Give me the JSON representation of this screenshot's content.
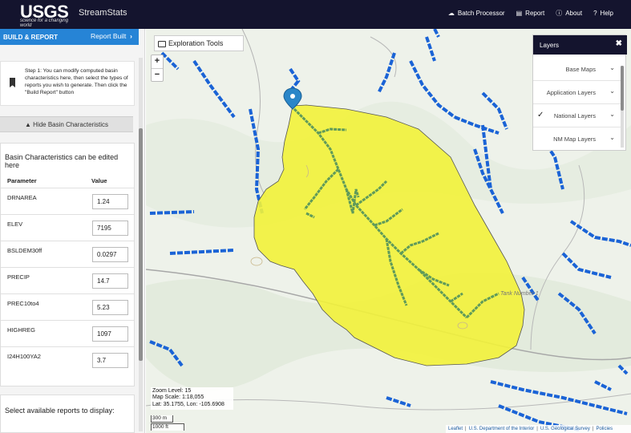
{
  "header": {
    "logo_text": "USGS",
    "logo_tagline": "science for a changing world",
    "app_title": "StreamStats",
    "nav": [
      {
        "label": "Batch Processor",
        "icon": "cloud-icon"
      },
      {
        "label": "Report",
        "icon": "document-icon"
      },
      {
        "label": "About",
        "icon": "info-icon"
      },
      {
        "label": "Help",
        "icon": "help-icon"
      }
    ],
    "background_color": "#14142e"
  },
  "sidebar": {
    "build_title": "BUILD & REPORT",
    "build_status": "Report Built",
    "build_chevron": "›",
    "step_text": "Step 1: You can modify computed basin characteristics here, then select the types of reports you wish to generate. Then click the \"Build Report\" button",
    "hide_button": "Hide Basin Characteristics",
    "basin_title": "Basin Characteristics can be edited here",
    "table_headers": {
      "parameter": "Parameter",
      "value": "Value"
    },
    "params": [
      {
        "name": "DRNAREA",
        "value": "1.24"
      },
      {
        "name": "ELEV",
        "value": "7195"
      },
      {
        "name": "BSLDEM30ff",
        "value": "0.0297"
      },
      {
        "name": "PRECIP",
        "value": "14.7"
      },
      {
        "name": "PREC10to4",
        "value": "5.23"
      },
      {
        "name": "HIGHREG",
        "value": "1097"
      },
      {
        "name": "I24H100YA2",
        "value": "3.7"
      }
    ],
    "select_reports_label": "Select available reports to display:",
    "accent_color": "#2684d6"
  },
  "map": {
    "exploration_tools": "Exploration Tools",
    "zoom_in": "+",
    "zoom_out": "−",
    "layers": {
      "title": "Layers",
      "close": "✖",
      "items": [
        {
          "label": "Base Maps",
          "checked": false
        },
        {
          "label": "Application Layers",
          "checked": false
        },
        {
          "label": "National Layers",
          "checked": true
        },
        {
          "label": "NM Map Layers",
          "checked": false
        }
      ]
    },
    "info": {
      "zoom_level": "Zoom Level: 15",
      "map_scale": "Map Scale: 1:18,055",
      "coords": "Lat: 35.1755, Lon: -105.6908"
    },
    "scale": {
      "metric": "300 m",
      "imperial": "1000 ft"
    },
    "tank_label": "Tank Number 1",
    "attribution": [
      "Leaflet",
      "U.S. Department of the Interior",
      "U.S. Geological Survey",
      "Policies"
    ],
    "basin_color": "#f2f23a",
    "stream_color": "#1a63d6"
  }
}
